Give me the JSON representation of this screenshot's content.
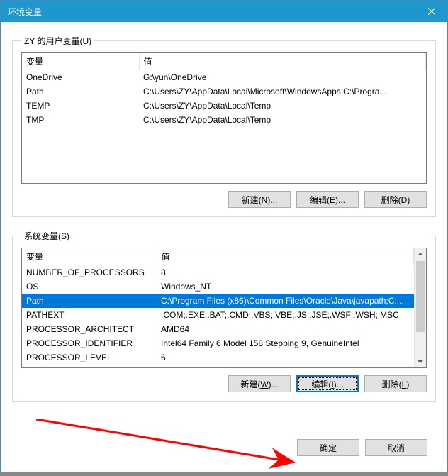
{
  "titlebar": {
    "title": "环境变量"
  },
  "user_section": {
    "legend_prefix": "ZY 的用户变量(",
    "legend_key": "U",
    "legend_suffix": ")",
    "col_var": "变量",
    "col_val": "值",
    "rows": [
      {
        "name": "OneDrive",
        "value": "G:\\yun\\OneDrive"
      },
      {
        "name": "Path",
        "value": "C:\\Users\\ZY\\AppData\\Local\\Microsoft\\WindowsApps;C:\\Progra..."
      },
      {
        "name": "TEMP",
        "value": "C:\\Users\\ZY\\AppData\\Local\\Temp"
      },
      {
        "name": "TMP",
        "value": "C:\\Users\\ZY\\AppData\\Local\\Temp"
      }
    ],
    "btn_new_prefix": "新建(",
    "btn_new_key": "N",
    "btn_new_suffix": ")...",
    "btn_edit_prefix": "编辑(",
    "btn_edit_key": "E",
    "btn_edit_suffix": ")...",
    "btn_del_prefix": "删除(",
    "btn_del_key": "D",
    "btn_del_suffix": ")"
  },
  "system_section": {
    "legend_prefix": "系统变量(",
    "legend_key": "S",
    "legend_suffix": ")",
    "col_var": "变量",
    "col_val": "值",
    "rows": [
      {
        "name": "NUMBER_OF_PROCESSORS",
        "value": "8"
      },
      {
        "name": "OS",
        "value": "Windows_NT"
      },
      {
        "name": "Path",
        "value": "C:\\Program Files (x86)\\Common Files\\Oracle\\Java\\javapath;C:..."
      },
      {
        "name": "PATHEXT",
        "value": ".COM;.EXE;.BAT;.CMD;.VBS;.VBE;.JS;.JSE;.WSF;.WSH;.MSC"
      },
      {
        "name": "PROCESSOR_ARCHITECT",
        "value": "AMD64"
      },
      {
        "name": "PROCESSOR_IDENTIFIER",
        "value": "Intel64 Family 6 Model 158 Stepping 9, GenuineIntel"
      },
      {
        "name": "PROCESSOR_LEVEL",
        "value": "6"
      }
    ],
    "selected_index": 2,
    "btn_new_prefix": "新建(",
    "btn_new_key": "W",
    "btn_new_suffix": ")...",
    "btn_edit_prefix": "编辑(",
    "btn_edit_key": "I",
    "btn_edit_suffix": ")...",
    "btn_del_prefix": "删除(",
    "btn_del_key": "L",
    "btn_del_suffix": ")"
  },
  "bottom": {
    "ok": "确定",
    "cancel": "取消"
  }
}
